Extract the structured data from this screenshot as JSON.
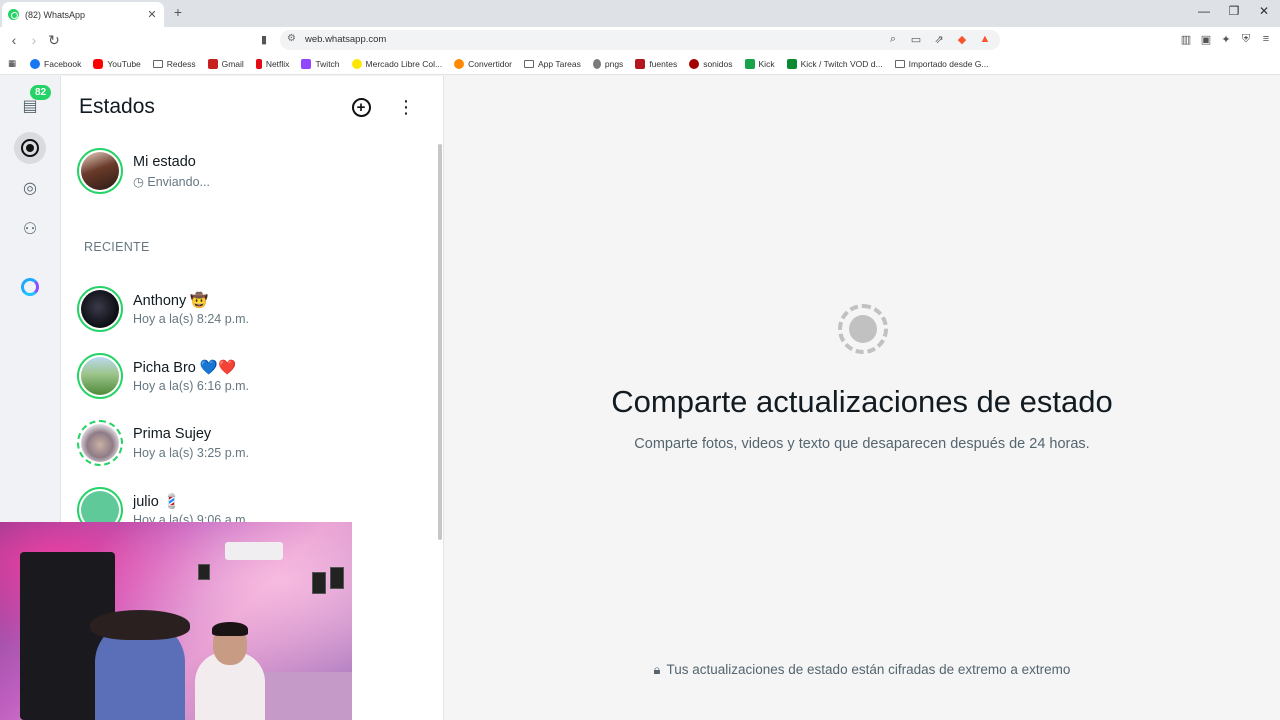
{
  "browser": {
    "tab_title": "(82) WhatsApp",
    "url": "web.whatsapp.com",
    "bookmarks": [
      {
        "label": "Facebook",
        "icon": "fb"
      },
      {
        "label": "YouTube",
        "icon": "yt"
      },
      {
        "label": "Redess",
        "icon": "folder"
      },
      {
        "label": "Gmail",
        "icon": "gm"
      },
      {
        "label": "Netflix",
        "icon": "nf"
      },
      {
        "label": "Twitch",
        "icon": "tw"
      },
      {
        "label": "Mercado Libre Col...",
        "icon": "ml"
      },
      {
        "label": "Convertidor",
        "icon": "cv"
      },
      {
        "label": "App Tareas",
        "icon": "folder"
      },
      {
        "label": "pngs",
        "icon": "pn"
      },
      {
        "label": "fuentes",
        "icon": "fu"
      },
      {
        "label": "sonidos",
        "icon": "so"
      },
      {
        "label": "Kick",
        "icon": "ki"
      },
      {
        "label": "Kick / Twitch VOD d...",
        "icon": "kt"
      },
      {
        "label": "Importado desde G...",
        "icon": "folder"
      }
    ]
  },
  "rail": {
    "chats_badge": "82"
  },
  "panel": {
    "title": "Estados",
    "my_status": {
      "name": "Mi estado",
      "sub": "Enviando..."
    },
    "section_label": "RECIENTE",
    "contacts": [
      {
        "name": "Anthony 🤠",
        "time": "Hoy a la(s) 8:24 p.m."
      },
      {
        "name": "Picha Bro 💙❤️",
        "time": "Hoy a la(s) 6:16 p.m."
      },
      {
        "name": "Prima Sujey",
        "time": "Hoy a la(s) 3:25 p.m."
      },
      {
        "name": "julio 💈",
        "time": "Hoy a la(s) 9:06 a.m."
      }
    ]
  },
  "main": {
    "title": "Comparte actualizaciones de estado",
    "subtitle": "Comparte fotos, videos y texto que desaparecen después de 24 horas.",
    "encryption": "Tus actualizaciones de estado están cifradas de extremo a extremo"
  },
  "colors": {
    "accent": "#25d366",
    "text": "#111b21",
    "muted": "#667781"
  }
}
